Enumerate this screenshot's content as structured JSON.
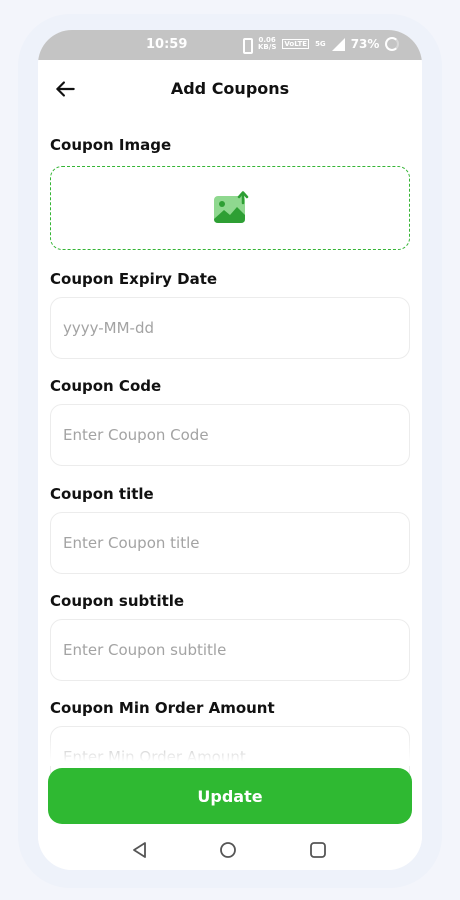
{
  "status_bar": {
    "time": "10:59",
    "net_speed_value": "0.06",
    "net_speed_unit": "KB/S",
    "volte": "VoLTE",
    "network": "5G",
    "battery": "73%"
  },
  "header": {
    "title": "Add Coupons"
  },
  "form": {
    "image_label": "Coupon Image",
    "expiry_label": "Coupon Expiry Date",
    "expiry_placeholder": "yyyy-MM-dd",
    "code_label": "Coupon Code",
    "code_placeholder": "Enter Coupon Code",
    "title_label": "Coupon title",
    "title_placeholder": "Enter Coupon title",
    "subtitle_label": "Coupon subtitle",
    "subtitle_placeholder": "Enter Coupon subtitle",
    "min_order_label": "Coupon Min Order Amount",
    "min_order_placeholder": "Enter Min Order Amount"
  },
  "actions": {
    "update_label": "Update"
  },
  "colors": {
    "accent": "#2fb932",
    "status_bar": "#c4c4c4"
  },
  "icons": [
    "back-arrow-icon",
    "image-upload-icon",
    "nav-back-icon",
    "nav-home-icon",
    "nav-recent-icon"
  ]
}
